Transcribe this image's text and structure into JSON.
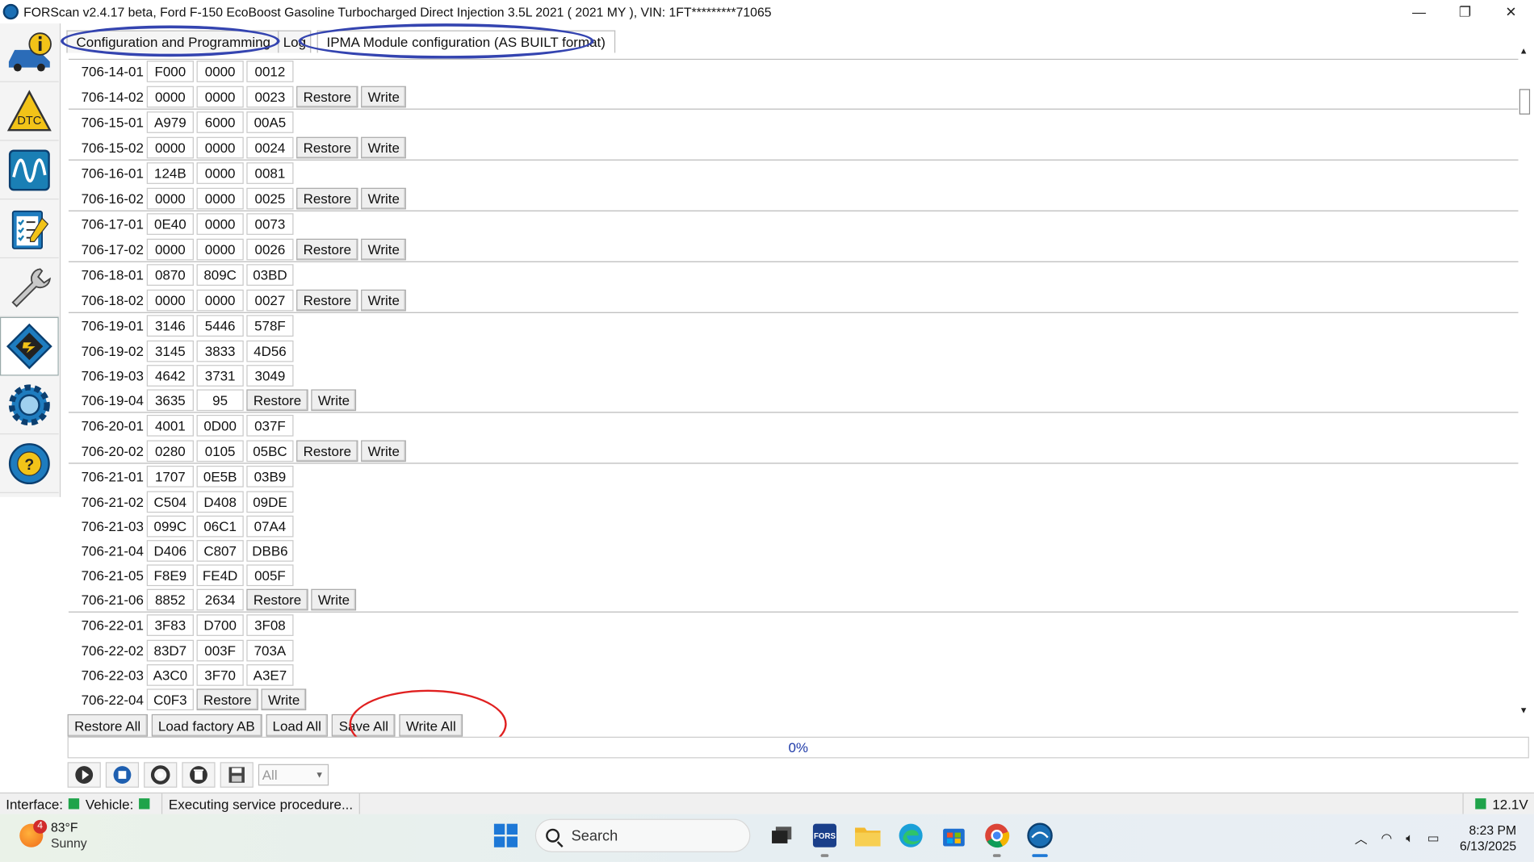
{
  "window": {
    "title": "FORScan v2.4.17 beta, Ford F-150 EcoBoost Gasoline Turbocharged Direct Injection 3.5L 2021 ( 2021 MY ), VIN: 1FT*********71065",
    "minimize": "—",
    "restore": "❐",
    "close": "✕"
  },
  "sidebar": {
    "items": [
      "vehicle-info",
      "dtc",
      "oscilloscope",
      "checklist",
      "service",
      "configuration",
      "settings",
      "help"
    ],
    "dtc_label": "DTC"
  },
  "tabs": [
    {
      "label": "Configuration and Programming"
    },
    {
      "label": "Log"
    },
    {
      "label": "IPMA Module configuration (AS BUILT format)"
    }
  ],
  "rows": [
    {
      "id": "706-14-01",
      "cells": [
        "F000",
        "0000",
        "0012"
      ],
      "buttons": false
    },
    {
      "id": "706-14-02",
      "cells": [
        "0000",
        "0000",
        "0023"
      ],
      "buttons": true
    },
    {
      "id": "706-15-01",
      "cells": [
        "A979",
        "6000",
        "00A5"
      ],
      "buttons": false
    },
    {
      "id": "706-15-02",
      "cells": [
        "0000",
        "0000",
        "0024"
      ],
      "buttons": true
    },
    {
      "id": "706-16-01",
      "cells": [
        "124B",
        "0000",
        "0081"
      ],
      "buttons": false
    },
    {
      "id": "706-16-02",
      "cells": [
        "0000",
        "0000",
        "0025"
      ],
      "buttons": true
    },
    {
      "id": "706-17-01",
      "cells": [
        "0E40",
        "0000",
        "0073"
      ],
      "buttons": false
    },
    {
      "id": "706-17-02",
      "cells": [
        "0000",
        "0000",
        "0026"
      ],
      "buttons": true
    },
    {
      "id": "706-18-01",
      "cells": [
        "0870",
        "809C",
        "03BD"
      ],
      "buttons": false
    },
    {
      "id": "706-18-02",
      "cells": [
        "0000",
        "0000",
        "0027"
      ],
      "buttons": true
    },
    {
      "id": "706-19-01",
      "cells": [
        "3146",
        "5446",
        "578F"
      ],
      "buttons": false
    },
    {
      "id": "706-19-02",
      "cells": [
        "3145",
        "3833",
        "4D56"
      ],
      "buttons": false
    },
    {
      "id": "706-19-03",
      "cells": [
        "4642",
        "3731",
        "3049"
      ],
      "buttons": false
    },
    {
      "id": "706-19-04",
      "cells": [
        "3635",
        "95"
      ],
      "buttons": true
    },
    {
      "id": "706-20-01",
      "cells": [
        "4001",
        "0D00",
        "037F"
      ],
      "buttons": false
    },
    {
      "id": "706-20-02",
      "cells": [
        "0280",
        "0105",
        "05BC"
      ],
      "buttons": true
    },
    {
      "id": "706-21-01",
      "cells": [
        "1707",
        "0E5B",
        "03B9"
      ],
      "buttons": false
    },
    {
      "id": "706-21-02",
      "cells": [
        "C504",
        "D408",
        "09DE"
      ],
      "buttons": false
    },
    {
      "id": "706-21-03",
      "cells": [
        "099C",
        "06C1",
        "07A4"
      ],
      "buttons": false
    },
    {
      "id": "706-21-04",
      "cells": [
        "D406",
        "C807",
        "DBB6"
      ],
      "buttons": false
    },
    {
      "id": "706-21-05",
      "cells": [
        "F8E9",
        "FE4D",
        "005F"
      ],
      "buttons": false
    },
    {
      "id": "706-21-06",
      "cells": [
        "8852",
        "2634"
      ],
      "buttons": true
    },
    {
      "id": "706-22-01",
      "cells": [
        "3F83",
        "D700",
        "3F08"
      ],
      "buttons": false
    },
    {
      "id": "706-22-02",
      "cells": [
        "83D7",
        "003F",
        "703A"
      ],
      "buttons": false
    },
    {
      "id": "706-22-03",
      "cells": [
        "A3C0",
        "3F70",
        "A3E7"
      ],
      "buttons": false
    },
    {
      "id": "706-22-04",
      "cells": [
        "C0F3"
      ],
      "buttons": true
    }
  ],
  "row_buttons": {
    "restore": "Restore",
    "write": "Write"
  },
  "bottom_buttons": {
    "restore_all": "Restore All",
    "load_factory": "Load factory AB",
    "load_all": "Load All",
    "save_all": "Save All",
    "write_all": "Write All"
  },
  "progress": {
    "value": 0,
    "label": "0%"
  },
  "toolbar": {
    "filter_value": "All"
  },
  "status": {
    "interface_label": "Interface:",
    "vehicle_label": "Vehicle:",
    "message": "Executing service procedure...",
    "voltage": "12.1V",
    "led_color": "#1fa34a"
  },
  "taskbar": {
    "weather_badge": "4",
    "temperature": "83°F",
    "condition": "Sunny",
    "search_placeholder": "Search",
    "time": "8:23 PM",
    "date": "6/13/2025"
  }
}
